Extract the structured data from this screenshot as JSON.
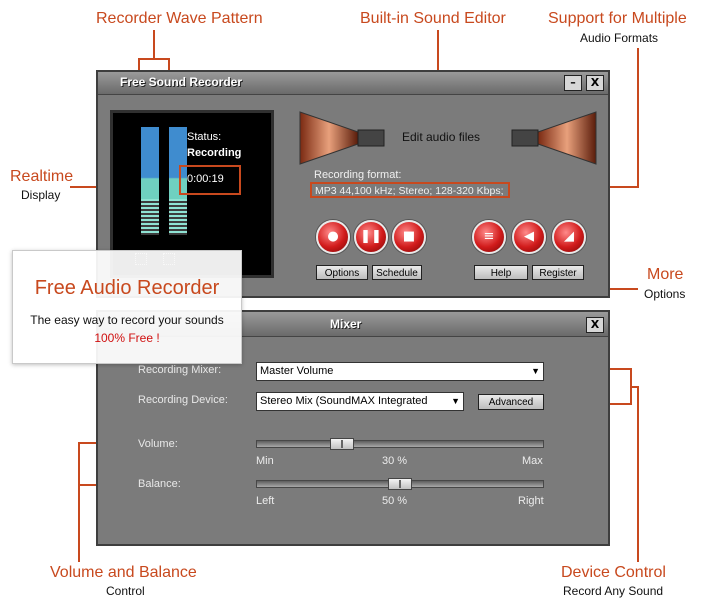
{
  "callouts": {
    "wave": {
      "title": "Recorder Wave Pattern"
    },
    "editor": {
      "title": "Built-in Sound Editor"
    },
    "formats": {
      "title": "Support for Multiple",
      "sub": "Audio Formats"
    },
    "realtime": {
      "title": "Realtime",
      "sub": "Display"
    },
    "more": {
      "title": "More",
      "sub": "Options"
    },
    "volume": {
      "title": "Volume and Balance",
      "sub": "Control"
    },
    "device": {
      "title": "Device Control",
      "sub": "Record Any Sound"
    }
  },
  "promo": {
    "title": "Free Audio Recorder",
    "tagline": "The easy way to record your sounds",
    "free": "100% Free !"
  },
  "recorder": {
    "title": "Free Sound Recorder",
    "minimize": "–",
    "close": "X",
    "status_label": "Status:",
    "status_value": "Recording",
    "time": "0:00:19",
    "edit_label": "Edit audio files",
    "format_label": "Recording format:",
    "format_value": "MP3 44,100 kHz; Stereo;  128-320 Kbps;",
    "options": "Options",
    "schedule": "Schedule",
    "help": "Help",
    "register": "Register",
    "buttons": {
      "record": "record-icon",
      "pause": "pause-icon",
      "stop": "stop-icon",
      "list": "list-icon",
      "play": "play-icon",
      "edit": "edit-icon"
    }
  },
  "mixer": {
    "title": "Mixer",
    "close": "X",
    "recording_mixer_label": "Recording Mixer:",
    "recording_mixer_value": "Master Volume",
    "recording_device_label": "Recording Device:",
    "recording_device_value": "Stereo Mix (SoundMAX Integrated",
    "advanced": "Advanced",
    "volume_label": "Volume:",
    "volume_min": "Min",
    "volume_value": "30 %",
    "volume_max": "Max",
    "volume_level": 0.3,
    "balance_label": "Balance:",
    "balance_left": "Left",
    "balance_value": "50 %",
    "balance_right": "Right",
    "balance_level": 0.5
  },
  "colors": {
    "accent": "#c8491e",
    "window": "#7b7b7b",
    "button_red": "#d11b1b"
  }
}
